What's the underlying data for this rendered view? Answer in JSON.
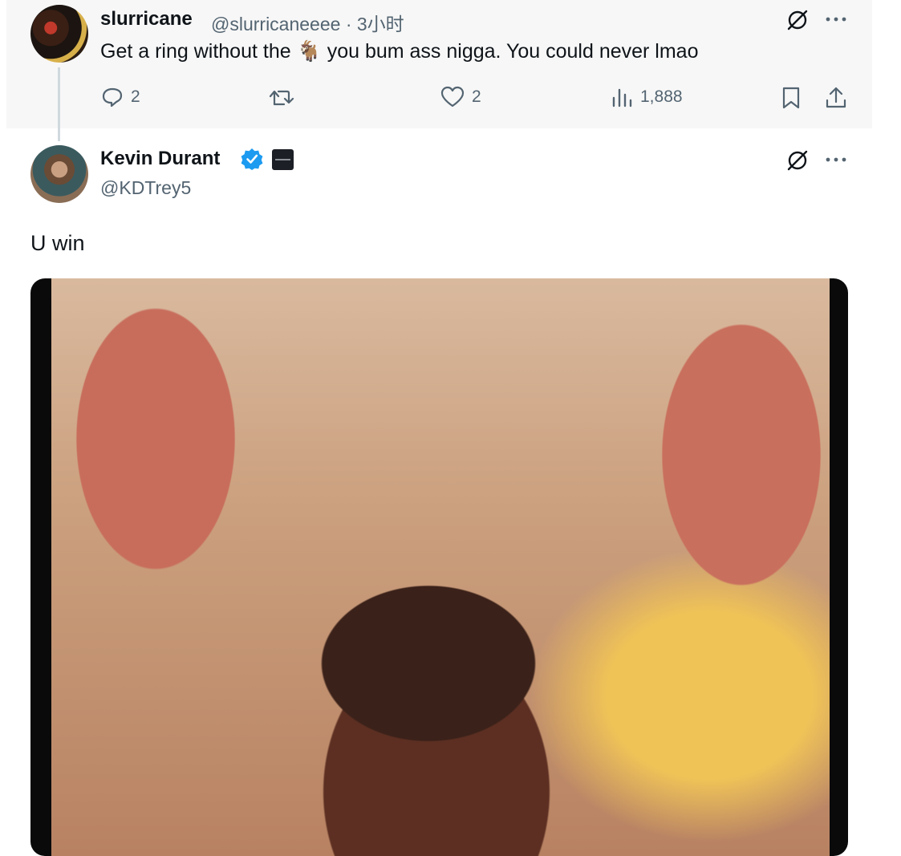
{
  "reply": {
    "name": "slurricane",
    "handle": "@slurricaneeee",
    "separator": "·",
    "time": "3小时",
    "text_before": "Get a ring without the",
    "emoji": "🐐",
    "text_after": "you bum ass nigga. You could never lmao",
    "replies": "2",
    "reposts": "",
    "likes": "2",
    "views": "1,888"
  },
  "main": {
    "name": "Kevin Durant",
    "handle": "@KDTrey5",
    "text": "U win",
    "verified_color": "#1d9bf0"
  },
  "colors": {
    "secondary_text": "#536471",
    "primary_text": "#0f1419",
    "reply_bg": "#f7f7f7"
  },
  "icons": [
    "grok-icon",
    "more-icon",
    "reply-icon",
    "repost-icon",
    "like-icon",
    "views-icon",
    "bookmark-icon",
    "share-icon",
    "verified-badge-icon",
    "affiliate-badge-icon"
  ]
}
